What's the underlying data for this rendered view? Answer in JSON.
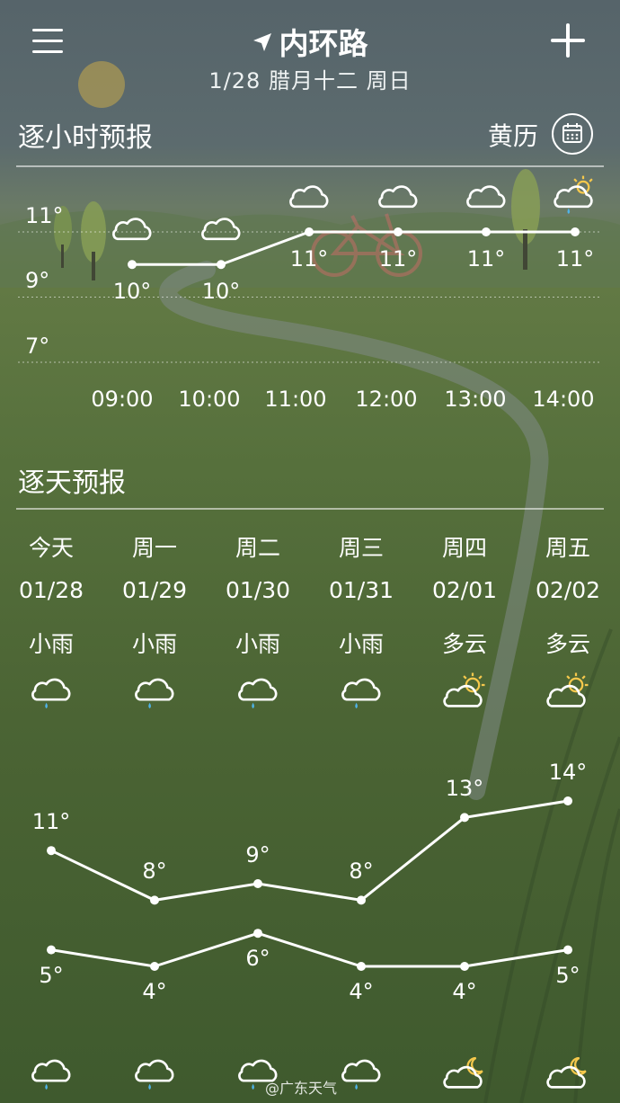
{
  "header": {
    "location": "内环路",
    "date_line": "1/28 腊月十二 周日"
  },
  "hourly": {
    "title": "逐小时预报",
    "almanac_label": "黄历",
    "y_labels": [
      "11°",
      "9°",
      "7°"
    ],
    "hours": [
      {
        "time": "09:00",
        "temp": "10°",
        "icon": "cloud-icon"
      },
      {
        "time": "10:00",
        "temp": "10°",
        "icon": "cloud-icon"
      },
      {
        "time": "11:00",
        "temp": "11°",
        "icon": "cloud-icon"
      },
      {
        "time": "12:00",
        "temp": "11°",
        "icon": "cloud-icon"
      },
      {
        "time": "13:00",
        "temp": "11°",
        "icon": "cloud-icon"
      },
      {
        "time": "14:00",
        "temp": "11°",
        "icon": "partly-cloudy-rain-icon"
      }
    ]
  },
  "daily": {
    "title": "逐天预报",
    "days": [
      {
        "week": "今天",
        "date": "01/28",
        "cond": "小雨",
        "high": "11°",
        "low": "5°",
        "day_icon": "light-rain-icon",
        "night_icon": "light-rain-icon"
      },
      {
        "week": "周一",
        "date": "01/29",
        "cond": "小雨",
        "high": "8°",
        "low": "4°",
        "day_icon": "light-rain-icon",
        "night_icon": "light-rain-icon"
      },
      {
        "week": "周二",
        "date": "01/30",
        "cond": "小雨",
        "high": "9°",
        "low": "6°",
        "day_icon": "light-rain-icon",
        "night_icon": "light-rain-icon"
      },
      {
        "week": "周三",
        "date": "01/31",
        "cond": "小雨",
        "high": "8°",
        "low": "4°",
        "day_icon": "light-rain-icon",
        "night_icon": "light-rain-icon"
      },
      {
        "week": "周四",
        "date": "02/01",
        "cond": "多云",
        "high": "13°",
        "low": "4°",
        "day_icon": "partly-cloudy-sun-icon",
        "night_icon": "partly-cloudy-moon-icon"
      },
      {
        "week": "周五",
        "date": "02/02",
        "cond": "多云",
        "high": "14°",
        "low": "5°",
        "day_icon": "partly-cloudy-sun-icon",
        "night_icon": "partly-cloudy-moon-icon"
      }
    ]
  },
  "chart_data": [
    {
      "type": "line",
      "x": [
        "09:00",
        "10:00",
        "11:00",
        "12:00",
        "13:00",
        "14:00"
      ],
      "series": [
        {
          "values": [
            10,
            10,
            11,
            11,
            11,
            11
          ]
        }
      ],
      "ylim": [
        7,
        11
      ],
      "y_ticks": [
        "11°",
        "9°",
        "7°"
      ],
      "grid": true
    },
    {
      "type": "line",
      "x": [
        "01/28",
        "01/29",
        "01/30",
        "01/31",
        "02/01",
        "02/02"
      ],
      "series": [
        {
          "values": [
            11,
            8,
            9,
            8,
            13,
            14
          ]
        },
        {
          "values": [
            5,
            4,
            6,
            4,
            4,
            5
          ]
        }
      ],
      "grid": false
    }
  ],
  "watermark": "@广东天气",
  "colors": {
    "line": "#ffffff",
    "rain_drop": "#4fb3e8",
    "sun": "#f5c84c",
    "moon": "#f5c84c"
  }
}
